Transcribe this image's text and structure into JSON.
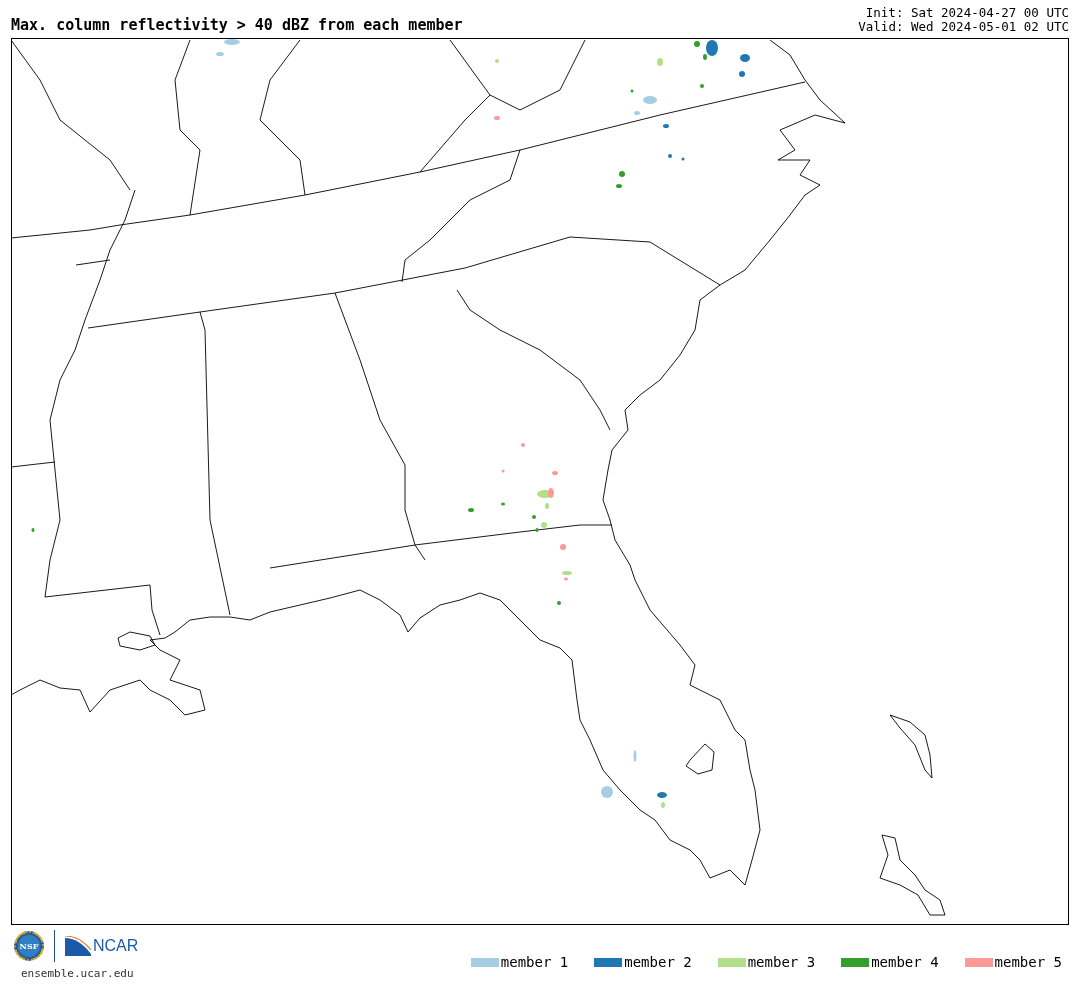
{
  "title": "Max. column reflectivity > 40 dBZ from each member",
  "init": "Init: Sat 2024-04-27 00 UTC",
  "valid": "Valid: Wed 2024-05-01 02 UTC",
  "logos": {
    "nsf": "NSF",
    "ncar": "NCAR"
  },
  "site": "ensemble.ucar.edu",
  "legend": [
    {
      "label": "member 1",
      "color": "#a6cee3"
    },
    {
      "label": "member 2",
      "color": "#1f78b4"
    },
    {
      "label": "member 3",
      "color": "#b2df8a"
    },
    {
      "label": "member 4",
      "color": "#33a02c"
    },
    {
      "label": "member 5",
      "color": "#fb9a99"
    }
  ]
}
